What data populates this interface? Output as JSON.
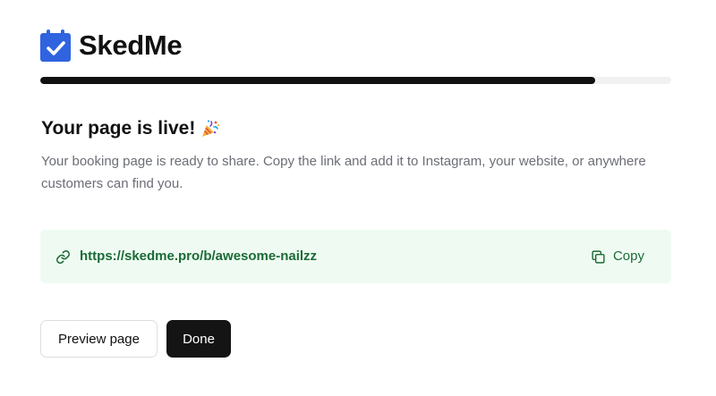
{
  "brand": {
    "name": "SkedMe",
    "icon": "calendar-check-icon",
    "color": "#2f63e0"
  },
  "progress": {
    "value_percent": 88
  },
  "content": {
    "heading": "Your page is live!",
    "heading_icon": "party-popper-icon",
    "description": "Your booking page is ready to share. Copy the link and add it to Instagram, your website, or anywhere customers can find you."
  },
  "share_link": {
    "icon": "link-icon",
    "url": "https://skedme.pro/b/awesome-nailzz",
    "copy_label": "Copy",
    "copy_icon": "copy-icon",
    "background_color": "#effbf2",
    "text_color": "#1b6a36"
  },
  "actions": {
    "preview_label": "Preview page",
    "done_label": "Done"
  }
}
